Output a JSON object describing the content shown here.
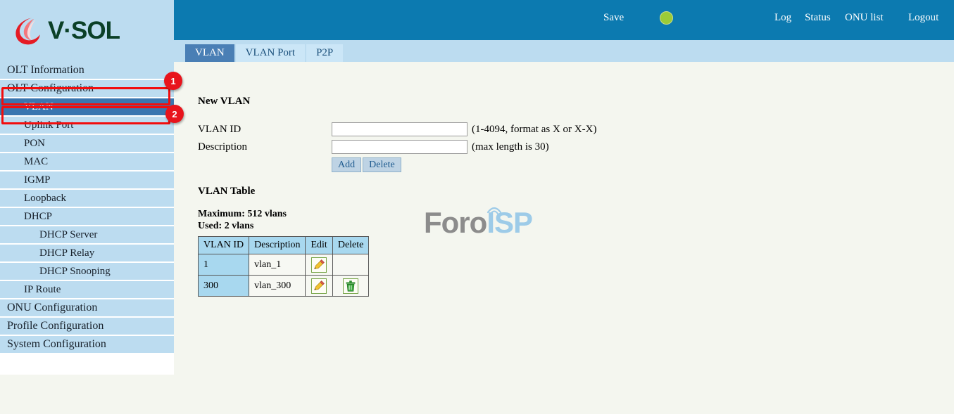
{
  "brand": {
    "logo_text": "V·SOL",
    "logo_mark": "vsol-flame-icon"
  },
  "header": {
    "save_label": "Save",
    "status_led": "green-status-indicator",
    "led_color": "#9ccb36",
    "links": [
      {
        "label": "Log"
      },
      {
        "label": "Status"
      },
      {
        "label": "ONU list"
      },
      {
        "label": "Logout"
      }
    ],
    "bar_color": "#0c7ab0"
  },
  "sidebar": {
    "items": [
      {
        "label": "OLT Information",
        "level": 0,
        "active": false
      },
      {
        "label": "OLT Configuration",
        "level": 0,
        "active": false
      },
      {
        "label": "VLAN",
        "level": 1,
        "active": true
      },
      {
        "label": "Uplink Port",
        "level": 1,
        "active": false
      },
      {
        "label": "PON",
        "level": 1,
        "active": false
      },
      {
        "label": "MAC",
        "level": 1,
        "active": false
      },
      {
        "label": "IGMP",
        "level": 1,
        "active": false
      },
      {
        "label": "Loopback",
        "level": 1,
        "active": false
      },
      {
        "label": "DHCP",
        "level": 1,
        "active": false
      },
      {
        "label": "DHCP Server",
        "level": 2,
        "active": false
      },
      {
        "label": "DHCP Relay",
        "level": 2,
        "active": false
      },
      {
        "label": "DHCP Snooping",
        "level": 2,
        "active": false
      },
      {
        "label": "IP Route",
        "level": 1,
        "active": false
      },
      {
        "label": "ONU Configuration",
        "level": 0,
        "active": false
      },
      {
        "label": "Profile Configuration",
        "level": 0,
        "active": false
      },
      {
        "label": "System Configuration",
        "level": 0,
        "active": false
      }
    ]
  },
  "annotations": {
    "color": "#f20d0d",
    "badges": [
      {
        "number": "1",
        "target": "OLT Configuration"
      },
      {
        "number": "2",
        "target": "VLAN"
      }
    ]
  },
  "tabs": [
    {
      "label": "VLAN",
      "active": true
    },
    {
      "label": "VLAN Port",
      "active": false
    },
    {
      "label": "P2P",
      "active": false
    }
  ],
  "new_vlan": {
    "title": "New VLAN",
    "fields": [
      {
        "label": "VLAN ID",
        "value": "",
        "placeholder": "",
        "hint": "(1-4094, format as X or X-X)"
      },
      {
        "label": "Description",
        "value": "",
        "placeholder": "",
        "hint": "(max length is 30)"
      }
    ],
    "buttons": [
      {
        "label": "Add"
      },
      {
        "label": "Delete"
      }
    ]
  },
  "vlan_table": {
    "title": "VLAN Table",
    "maximum_line": "Maximum: 512 vlans",
    "used_line": "Used: 2 vlans",
    "columns": [
      "VLAN ID",
      "Description",
      "Edit",
      "Delete"
    ],
    "rows": [
      {
        "vlan_id": "1",
        "description": "vlan_1",
        "edit": "edit-pencil-icon",
        "delete": ""
      },
      {
        "vlan_id": "300",
        "description": "vlan_300",
        "edit": "edit-pencil-icon",
        "delete": "delete-trash-icon"
      }
    ]
  },
  "watermark": {
    "text_primary": "Foro",
    "text_secondary": "ISP",
    "color_primary": "#8c8c8c",
    "color_secondary": "#9dcbe8"
  }
}
